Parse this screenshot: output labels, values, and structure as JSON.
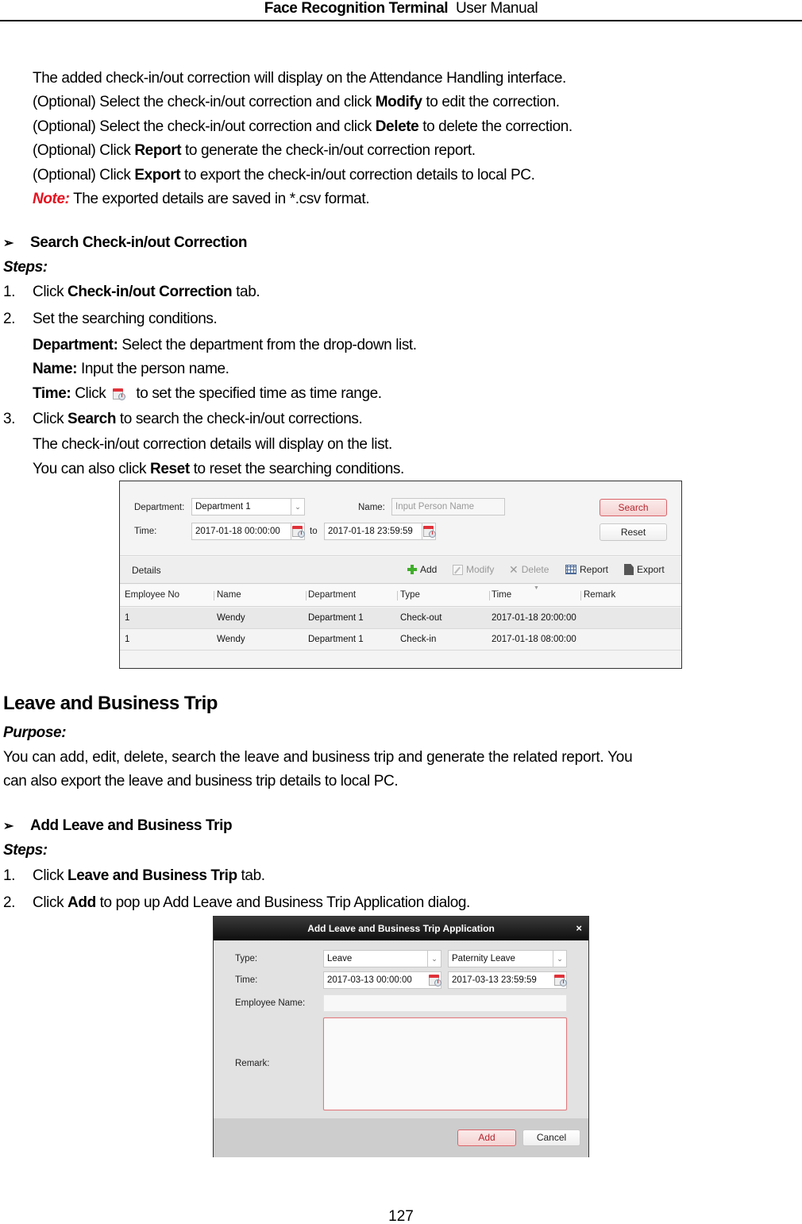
{
  "header": {
    "title_bold": "Face Recognition Terminal",
    "title_regular": "User Manual"
  },
  "intro_lines": [
    {
      "pre": "The added check-in/out correction will display on the Attendance Handling interface.",
      "bold": "",
      "post": ""
    },
    {
      "pre": "(Optional) Select the check-in/out correction and click ",
      "bold": "Modify",
      "post": " to edit the correction."
    },
    {
      "pre": "(Optional) Select the check-in/out correction and click ",
      "bold": "Delete",
      "post": " to delete the correction."
    },
    {
      "pre": "(Optional) Click ",
      "bold": "Report",
      "post": " to generate the check-in/out correction report."
    },
    {
      "pre": "(Optional) Click ",
      "bold": "Export",
      "post": " to export the check-in/out correction details to local PC."
    }
  ],
  "note": {
    "label": "Note:",
    "text": " The exported details are saved in *.csv format."
  },
  "search_section": {
    "heading": "Search Check-in/out Correction",
    "steps_label": "Steps:",
    "step1": {
      "num": "1.",
      "pre": "Click ",
      "bold": "Check-in/out Correction",
      "post": " tab."
    },
    "step2": {
      "num": "2.",
      "text": "Set the searching conditions."
    },
    "dept": {
      "bold": "Department:",
      "text": " Select the department from the drop-down list."
    },
    "name": {
      "bold": "Name:",
      "text": " Input the person name."
    },
    "time": {
      "bold": "Time:",
      "pre": " Click",
      "post": "to set the specified time as time range."
    },
    "step3": {
      "num": "3.",
      "pre": "Click ",
      "bold": "Search",
      "post": " to search the check-in/out corrections."
    },
    "step3_line2": "The check-in/out correction details will display on the list.",
    "step3_line3": {
      "pre": "You can also click ",
      "bold": "Reset",
      "post": " to reset the searching conditions."
    }
  },
  "screenshot1": {
    "department_label": "Department:",
    "department_value": "Department 1",
    "name_label": "Name:",
    "name_placeholder": "Input Person Name",
    "time_label": "Time:",
    "time_from": "2017-01-18 00:00:00",
    "time_to_label": "to",
    "time_to": "2017-01-18 23:59:59",
    "search_button": "Search",
    "reset_button": "Reset",
    "details_label": "Details",
    "toolbar": {
      "add": "Add",
      "modify": "Modify",
      "delete": "Delete",
      "report": "Report",
      "export": "Export"
    },
    "columns": [
      "Employee No",
      "Name",
      "Department",
      "Type",
      "Time",
      "Remark"
    ],
    "rows": [
      {
        "employee_no": "1",
        "name": "Wendy",
        "department": "Department 1",
        "type": "Check-out",
        "time": "2017-01-18 20:00:00",
        "remark": ""
      },
      {
        "employee_no": "1",
        "name": "Wendy",
        "department": "Department 1",
        "type": "Check-in",
        "time": "2017-01-18 08:00:00",
        "remark": ""
      }
    ]
  },
  "leave_section": {
    "title": "Leave and Business Trip",
    "purpose_label": "Purpose:",
    "purpose_line1": "You can add, edit, delete, search the leave and business trip and generate the related report. You",
    "purpose_line2": "can also export the leave and business trip details to local PC.",
    "add_heading": "Add Leave and Business Trip",
    "steps_label": "Steps:",
    "step1": {
      "num": "1.",
      "pre": "Click ",
      "bold": "Leave and Business Trip",
      "post": " tab."
    },
    "step2": {
      "num": "2.",
      "pre": "Click ",
      "bold": "Add",
      "post": " to pop up Add Leave and Business Trip Application dialog."
    }
  },
  "dialog": {
    "title": "Add Leave and Business Trip Application",
    "close": "×",
    "type_label": "Type:",
    "type_value": "Leave",
    "subtype_value": "Paternity Leave",
    "time_label": "Time:",
    "time_from": "2017-03-13 00:00:00",
    "time_to": "2017-03-13 23:59:59",
    "employee_label": "Employee Name:",
    "employee_value": "",
    "remark_label": "Remark:",
    "remark_value": "",
    "add_button": "Add",
    "cancel_button": "Cancel"
  },
  "page_number": "127",
  "colors": {
    "note_red": "#e8101e",
    "accent_red": "#d9646a",
    "add_green": "#3fae2a"
  }
}
